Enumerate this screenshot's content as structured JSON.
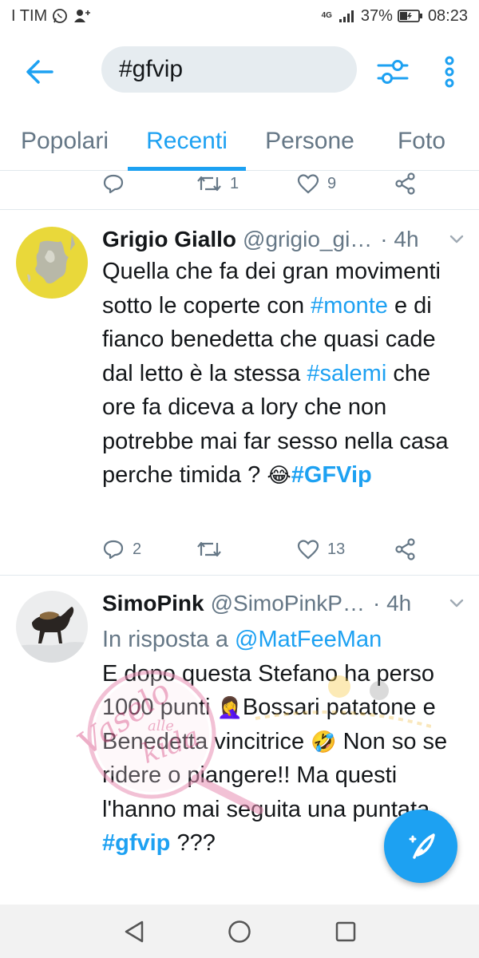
{
  "status_bar": {
    "carrier": "I TIM",
    "network": "4G",
    "battery": "37%",
    "time": "08:23"
  },
  "search": {
    "query": "#gfvip"
  },
  "tabs": [
    {
      "label": "Popolari"
    },
    {
      "label": "Recenti"
    },
    {
      "label": "Persone"
    },
    {
      "label": "Foto"
    }
  ],
  "prev_tweet": {
    "retweets": "1",
    "likes": "9"
  },
  "tweet1": {
    "name": "Grigio Giallo",
    "handle": "@grigio_gi…",
    "time": "· 4h",
    "body": {
      "p1": "Quella che fa dei gran movimenti sotto le coperte con ",
      "h1": "#monte",
      "p2": " e di fianco benedetta che quasi cade dal letto è la stessa ",
      "h2": "#salemi",
      "p3": " che ore fa diceva a lory che non potrebbe mai far sesso nella casa perche timida ? ",
      "emoji": "😂",
      "h3": "#GFVip"
    },
    "replies": "2",
    "likes": "13"
  },
  "tweet2": {
    "name": "SimoPink",
    "handle": "@SimoPinkP…",
    "time": "· 4h",
    "reply_prefix": "In risposta a ",
    "reply_mention": "@MatFeeMan",
    "body": {
      "p1": "E dopo questa Stefano ha perso 1000 punti ",
      "emoji1": "🤦‍♀️",
      "p2": "Bossari patatone e Benedetta vincitrice ",
      "emoji2": "🤣",
      "p3": " Non so se ridere o piangere!! Ma questi l'hanno mai seguita una puntata ",
      "h1": "#gfvip",
      "p4": " ???"
    }
  },
  "watermark": {
    "line1": "Vaselo",
    "line2": "alle",
    "line3": "kida"
  },
  "icons": {
    "back": "arrow-left-icon",
    "filter": "sliders-icon",
    "more": "more-vertical-icon",
    "reply": "reply-icon",
    "retweet": "retweet-icon",
    "like": "heart-icon",
    "share": "share-icon",
    "compose": "compose-tweet-icon"
  },
  "colors": {
    "accent": "#1da1f2",
    "secondary_text": "#657786",
    "divider": "#e1e8ed",
    "search_bg": "#e6ecf0"
  }
}
